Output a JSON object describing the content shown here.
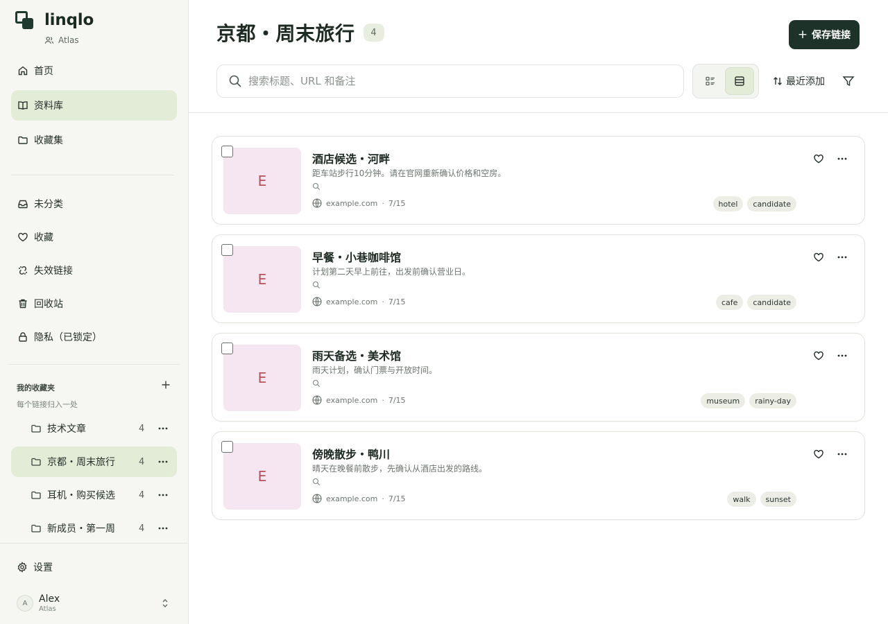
{
  "app": {
    "name": "linqlo",
    "workspace": "Atlas"
  },
  "nav": [
    {
      "label": "首页",
      "icon": "home-icon"
    },
    {
      "label": "资料库",
      "icon": "book-icon",
      "active": true
    },
    {
      "label": "收藏集",
      "icon": "folder-icon"
    }
  ],
  "nav2": [
    {
      "label": "未分类",
      "icon": "inbox-icon"
    },
    {
      "label": "收藏",
      "icon": "heart-icon"
    },
    {
      "label": "失效链接",
      "icon": "broken-link-icon"
    },
    {
      "label": "回收站",
      "icon": "trash-icon"
    },
    {
      "label": "隐私（已锁定）",
      "icon": "lock-icon"
    }
  ],
  "collections_section": {
    "title": "我的收藏夹",
    "subtitle": "每个链接归入一处"
  },
  "collections": [
    {
      "label": "技术文章",
      "count": "4"
    },
    {
      "label": "京都・周末旅行",
      "count": "4",
      "active": true
    },
    {
      "label": "耳机・购买候选",
      "count": "4"
    },
    {
      "label": "新成员・第一周",
      "count": "4"
    }
  ],
  "footer": {
    "settings_label": "设置",
    "user_name": "Alex",
    "user_initial": "A",
    "user_workspace": "Atlas"
  },
  "header": {
    "title": "京都・周末旅行",
    "count": "4",
    "save_label": "保存链接"
  },
  "search": {
    "placeholder": "搜索标题、URL 和备注"
  },
  "sort": {
    "label": "最近添加"
  },
  "cards": [
    {
      "thumb": "E",
      "title": "酒店候选・河畔",
      "note": "距车站步行10分钟。请在官网重新确认价格和空房。",
      "domain": "example.com",
      "sep": "·",
      "date": "7/15",
      "tags": [
        "hotel",
        "candidate"
      ]
    },
    {
      "thumb": "E",
      "title": "早餐・小巷咖啡馆",
      "note": "计划第二天早上前往，出发前确认营业日。",
      "domain": "example.com",
      "sep": "·",
      "date": "7/15",
      "tags": [
        "cafe",
        "candidate"
      ]
    },
    {
      "thumb": "E",
      "title": "雨天备选・美术馆",
      "note": "雨天计划，确认门票与开放时间。",
      "domain": "example.com",
      "sep": "·",
      "date": "7/15",
      "tags": [
        "museum",
        "rainy-day"
      ]
    },
    {
      "thumb": "E",
      "title": "傍晚散步・鸭川",
      "note": "晴天在晚餐前散步，先确认从酒店出发的路线。",
      "domain": "example.com",
      "sep": "·",
      "date": "7/15",
      "tags": [
        "walk",
        "sunset"
      ]
    }
  ]
}
